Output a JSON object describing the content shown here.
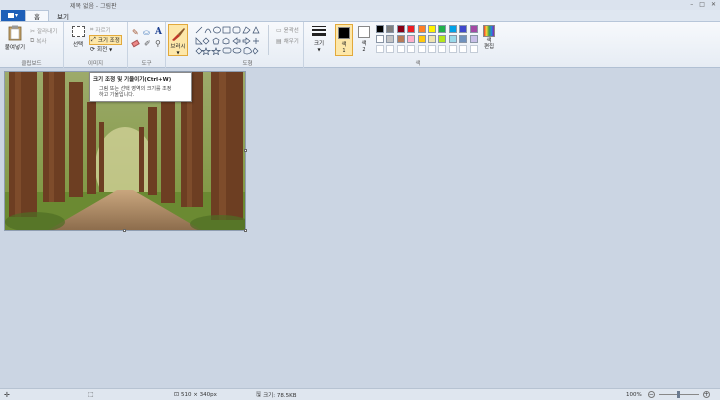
{
  "window": {
    "title": "제목 없음 - 그림판",
    "controls": [
      "–",
      "□",
      "✕"
    ]
  },
  "tabs": {
    "file_label": "▾",
    "home": "홈",
    "view": "보기"
  },
  "clipboard": {
    "paste": "붙여넣기",
    "cut": "잘라내기",
    "copy": "복사",
    "group_label": "클립보드"
  },
  "image": {
    "select": "선택",
    "crop": "자르기",
    "resize": "크기 조정",
    "rotate": "회전",
    "group_label": "이미지"
  },
  "tools": {
    "text_tool": "A",
    "group_label": "도구"
  },
  "brushes": {
    "label": "브러시"
  },
  "shapes": {
    "outline": "윤곽선",
    "fill": "채우기",
    "group_label": "도형"
  },
  "size": {
    "label": "크기"
  },
  "colors": {
    "color1_label": "색",
    "color1_num": "1",
    "color2_label": "색",
    "color2_num": "2",
    "edit_label": "색\n편집",
    "group_label": "색",
    "row1": [
      "#000000",
      "#7f7f7f",
      "#880015",
      "#ed1c24",
      "#ff7f27",
      "#fff200",
      "#22b14c",
      "#00a2e8",
      "#3f48cc",
      "#a349a4"
    ],
    "row2": [
      "#ffffff",
      "#c3c3c3",
      "#b97a57",
      "#ffaec9",
      "#ffc90e",
      "#efe4b0",
      "#b5e61d",
      "#99d9ea",
      "#7092be",
      "#c8bfe7"
    ],
    "row3": [
      "#ffffff",
      "#ffffff",
      "#ffffff",
      "#ffffff",
      "#ffffff",
      "#ffffff",
      "#ffffff",
      "#ffffff",
      "#ffffff",
      "#ffffff"
    ]
  },
  "tooltip": {
    "title": "크기 조정 및 기울이기(Ctrl+W)",
    "body_line1": "그림 또는 선택 영역의 크기를 조정",
    "body_line2": "하고 기울입니다."
  },
  "status": {
    "dimensions": "510 × 340px",
    "filesize": "크기: 78.5KB",
    "zoom": "100%"
  }
}
